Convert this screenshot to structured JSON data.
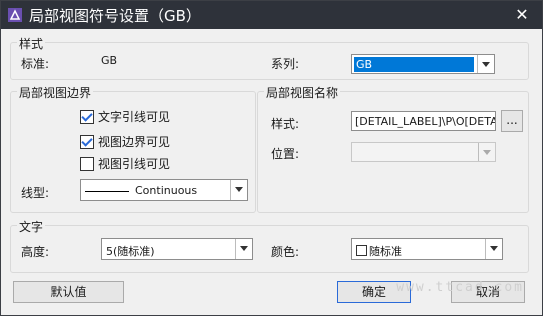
{
  "window": {
    "title": "局部视图符号设置（GB）",
    "close_glyph": "✕"
  },
  "style_group": {
    "title": "样式",
    "standard_label": "标准:",
    "standard_value": "GB",
    "series_label": "系列:",
    "series_value": "GB"
  },
  "border_group": {
    "title": "局部视图边界",
    "checkboxes": [
      {
        "label": "文字引线可见",
        "checked": true
      },
      {
        "label": "视图边界可见",
        "checked": true
      },
      {
        "label": "视图引线可见",
        "checked": false
      }
    ],
    "linetype_label": "线型:",
    "linetype_value": "Continuous"
  },
  "name_group": {
    "title": "局部视图名称",
    "style_label": "样式:",
    "style_value": "[DETAIL_LABEL]\\P\\O[DETAIL_",
    "browse_label": "...",
    "position_label": "位置:",
    "position_value": ""
  },
  "text_group": {
    "title": "文字",
    "height_label": "高度:",
    "height_value": "5(随标准)",
    "color_label": "颜色:",
    "color_value": "随标准"
  },
  "buttons": {
    "default": "默认值",
    "ok": "确定",
    "cancel": "取消"
  },
  "watermark": "www.ttcad.com",
  "colors": {
    "titlebar": "#2e323a",
    "selection": "#0078d7",
    "check": "#2a6ad8"
  }
}
